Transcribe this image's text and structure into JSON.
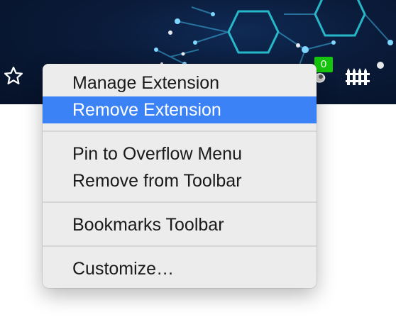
{
  "toolbar": {
    "badge_count": "0",
    "icons": [
      "star-icon",
      "extension-icon",
      "fence-icon"
    ],
    "background_color": "#0a1a38"
  },
  "context_menu": {
    "items": [
      {
        "label": "Manage Extension",
        "highlighted": false
      },
      {
        "label": "Remove Extension",
        "highlighted": true
      },
      {
        "label": "Pin to Overflow Menu",
        "highlighted": false
      },
      {
        "label": "Remove from Toolbar",
        "highlighted": false
      },
      {
        "label": "Bookmarks Toolbar",
        "highlighted": false
      },
      {
        "label": "Customize…",
        "highlighted": false
      }
    ],
    "highlight_color": "#3a82f6"
  }
}
